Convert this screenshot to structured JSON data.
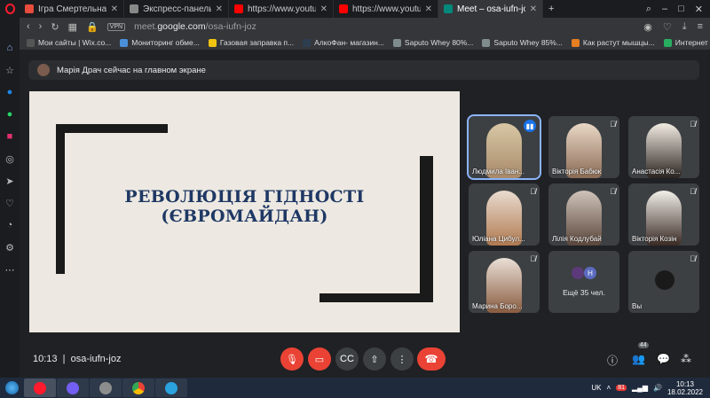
{
  "browser": {
    "tabs": [
      {
        "title": "Ігра Смертельна гонка он",
        "color": "#e74c3c"
      },
      {
        "title": "Экспресс-панель",
        "color": "#888888"
      },
      {
        "title": "https://www.youtube.com/v",
        "color": "#ff0000"
      },
      {
        "title": "https://www.youtube.com/v",
        "color": "#ff0000"
      },
      {
        "title": "Meet – osa-iufn-joz",
        "color": "#00897b"
      }
    ],
    "url_prefix": "meet.",
    "url_domain": "google.com",
    "url_path": "/osa-iufn-joz",
    "vpn_label": "VPN",
    "bookmarks": [
      {
        "label": "Мои сайты | Wix.co...",
        "color": "#555555"
      },
      {
        "label": "Мониторинг обме...",
        "color": "#4a90d9"
      },
      {
        "label": "Газовая заправка п...",
        "color": "#f1c40f"
      },
      {
        "label": "АлкоФан- магазин...",
        "color": "#2c3e50"
      },
      {
        "label": "Saputo Whey 80%...",
        "color": "#7f8c8d"
      },
      {
        "label": "Saputo Whey 85%...",
        "color": "#7f8c8d"
      },
      {
        "label": "Как растут мышцы...",
        "color": "#e67e22"
      },
      {
        "label": "Интернет магазин...",
        "color": "#27ae60"
      }
    ]
  },
  "meet": {
    "presenting_banner": "Марія Драч сейчас на главном экране",
    "slide": {
      "title_line1": "РЕВОЛЮЦІЯ ГІДНОСТІ",
      "title_line2": "(ЄВРОМАЙДАН)"
    },
    "participants": [
      {
        "name": "Людмила Іван...",
        "speaking": true
      },
      {
        "name": "Вікторія Бабюк",
        "speaking": false
      },
      {
        "name": "Анастасія Ко...",
        "speaking": false
      },
      {
        "name": "Юліана Цибул...",
        "speaking": false
      },
      {
        "name": "Лілія Кодлубай",
        "speaking": false
      },
      {
        "name": "Вікторія Козін",
        "speaking": false
      },
      {
        "name": "Марина Боро...",
        "speaking": false
      }
    ],
    "more_tile": {
      "label": "Ещё 35 чел.",
      "avatar_letter": "H"
    },
    "you_tile": {
      "label": "Вы"
    },
    "time": "10:13",
    "meeting_code": "osa-iufn-joz",
    "participant_count": "44"
  },
  "taskbar": {
    "lang": "UK",
    "time": "10:13",
    "date": "18.02.2022",
    "badge": "81"
  }
}
